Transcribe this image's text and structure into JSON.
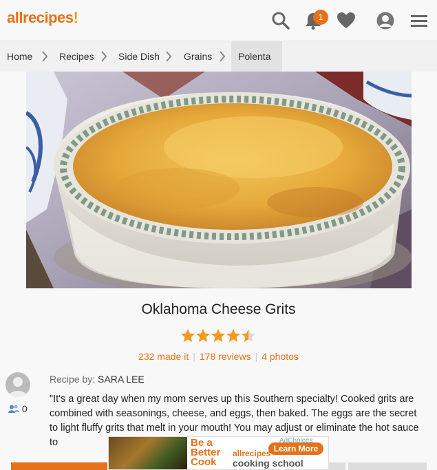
{
  "header": {
    "logo_text": "allrecipes",
    "logo_bang": "!",
    "notification_count": "1"
  },
  "breadcrumb": [
    {
      "label": "Home"
    },
    {
      "label": "Recipes"
    },
    {
      "label": "Side Dish"
    },
    {
      "label": "Grains"
    },
    {
      "label": "Polenta"
    }
  ],
  "recipe": {
    "title": "Oklahoma Cheese Grits",
    "rating": 4.5,
    "made_it": "232 made it",
    "reviews": "178 reviews",
    "photos": "4 photos",
    "recipe_by_label": "Recipe by:",
    "author": "SARA LEE",
    "followers": "0",
    "description": "\"It's a great day when my mom serves up this Southern specialty! Cooked grits are combined with seasonings, cheese, and eggs, then baked. The eggs are the secret to light fluffy grits that melt in your mouth! You may adjust or eliminate the hot sauce to"
  },
  "ad": {
    "headline_1": "Be a",
    "headline_2": "Better",
    "headline_3": "Cook",
    "brand": "allrecipes",
    "brand_sub": "cooking school",
    "cta": "Learn More",
    "choices": "AdChoices"
  },
  "colors": {
    "accent": "#e5721a",
    "star": "#f39a1e"
  }
}
